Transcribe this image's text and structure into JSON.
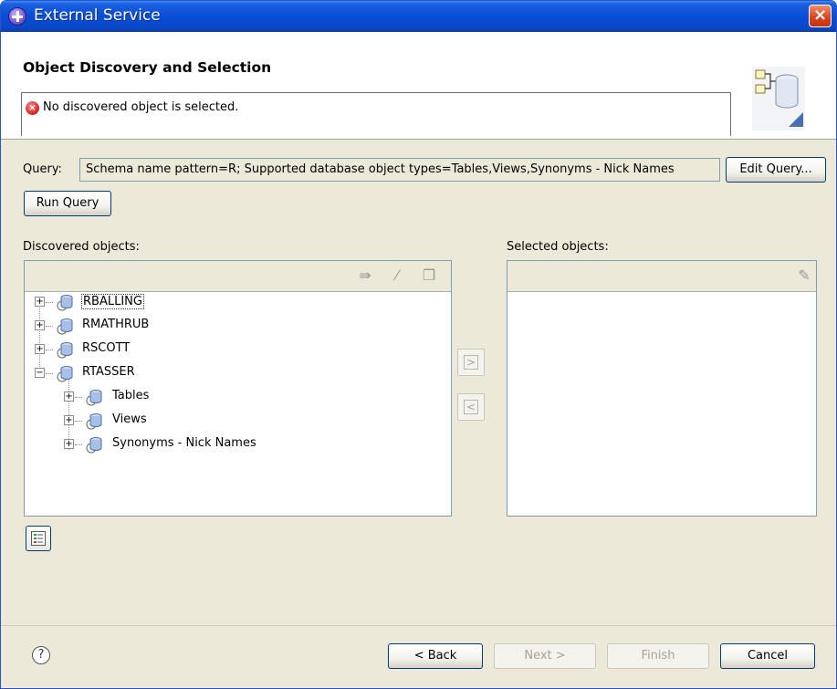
{
  "window": {
    "title": "External Service",
    "close_label": "×"
  },
  "header": {
    "page_title": "Object Discovery and Selection",
    "error_glyph": "×",
    "message": "No discovered object is selected."
  },
  "query": {
    "label": "Query:",
    "value": "Schema name pattern=R; Supported database object types=Tables,Views,Synonyms - Nick Names",
    "edit_button": "Edit Query...",
    "run_button": "Run Query"
  },
  "discovered": {
    "label": "Discovered objects:",
    "tree": [
      {
        "label": "RBALLING",
        "expanded": false,
        "level": 0,
        "focused": true
      },
      {
        "label": "RMATHRUB",
        "expanded": false,
        "level": 0
      },
      {
        "label": "RSCOTT",
        "expanded": false,
        "level": 0
      },
      {
        "label": "RTASSER",
        "expanded": true,
        "level": 0
      },
      {
        "label": "Tables",
        "expanded": false,
        "level": 1
      },
      {
        "label": "Views",
        "expanded": false,
        "level": 1
      },
      {
        "label": "Synonyms - Nick Names",
        "expanded": false,
        "level": 1
      }
    ],
    "toolbar_icons": [
      "filter-icon",
      "edit-icon",
      "book-icon"
    ]
  },
  "transfer": {
    "add_glyph": ">",
    "remove_glyph": "<"
  },
  "selected": {
    "label": "Selected objects:",
    "toolbar_icons": [
      "pencil-icon"
    ]
  },
  "help_glyph": "?",
  "footer": {
    "back": "< Back",
    "next": "Next >",
    "finish": "Finish",
    "cancel": "Cancel"
  }
}
